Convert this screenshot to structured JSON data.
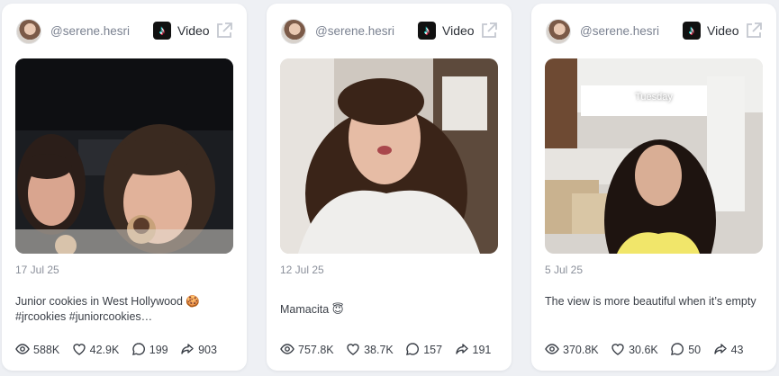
{
  "posts": [
    {
      "username": "@serene.hesri",
      "platform_icon": "tiktok-icon",
      "type": "Video",
      "date": "17 Jul 25",
      "caption": "Junior cookies in West Hollywood 🍪 #jrcookies #juniorcookies…",
      "overlay_text": "",
      "stats": {
        "views": "588K",
        "likes": "42.9K",
        "comments": "199",
        "shares": "903"
      }
    },
    {
      "username": "@serene.hesri",
      "platform_icon": "tiktok-icon",
      "type": "Video",
      "date": "12 Jul 25",
      "caption": "Mamacita 😇",
      "overlay_text": "",
      "stats": {
        "views": "757.8K",
        "likes": "38.7K",
        "comments": "157",
        "shares": "191"
      }
    },
    {
      "username": "@serene.hesri",
      "platform_icon": "tiktok-icon",
      "type": "Video",
      "date": "5 Jul 25",
      "caption": "The view is more beautiful when it’s empty",
      "overlay_text": "Tuesday",
      "stats": {
        "views": "370.8K",
        "likes": "30.6K",
        "comments": "50",
        "shares": "43"
      }
    }
  ],
  "colors": {
    "page_bg": "#eef0f4",
    "card_bg": "#ffffff",
    "muted_text": "#8a8f9a",
    "body_text": "#3a3f47"
  }
}
